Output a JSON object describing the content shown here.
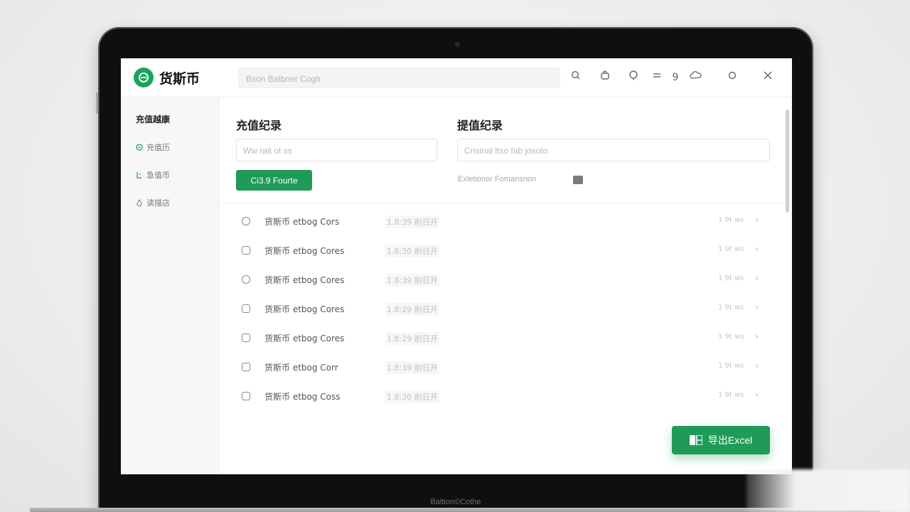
{
  "device": {
    "chin_label": "Baltion©Cothe"
  },
  "header": {
    "brand": "货斯币",
    "search_placeholder": "Bson Batbner Cogh",
    "icons": [
      "search-icon",
      "bag-icon",
      "badge-icon",
      "equals-icon",
      "number-9-icon",
      "cloud-icon",
      "circle-icon",
      "close-icon"
    ],
    "nine_label": "9"
  },
  "sidebar": {
    "title": "充值越康",
    "items": [
      {
        "label": "充值历",
        "icon": "clock-circle-icon"
      },
      {
        "label": "急值币",
        "icon": "document-icon"
      },
      {
        "label": "读描店",
        "icon": "drop-icon"
      }
    ]
  },
  "recharge": {
    "title": "充值纪录",
    "input_placeholder": "Ww rait ot ss",
    "button_label": "Ci3.9 Fourte"
  },
  "withdraw": {
    "title": "提值纪录",
    "input_placeholder": "Crisinal ltso fab josoto",
    "hint": "Exletionor Fomansnon"
  },
  "rows": [
    {
      "name": "货斯币 etbog Cors",
      "time": "1.8:39 削日开",
      "value": "1 9t ws",
      "icon": "round"
    },
    {
      "name": "货斯币 etbog Cores",
      "time": "1.8:30 削日开",
      "value": "1 9t ws",
      "icon": "square"
    },
    {
      "name": "货斯币 etbog Cores",
      "time": "1.8:39 削日开",
      "value": "1 9t ws",
      "icon": "round"
    },
    {
      "name": "货斯币 etbog Cores",
      "time": "1.8:29 削日开",
      "value": "1 9t ws",
      "icon": "square"
    },
    {
      "name": "货斯币 etbog Cores",
      "time": "1.8:29 削日开",
      "value": "1 9t ws",
      "icon": "square"
    },
    {
      "name": "货斯币 etbog Corr",
      "time": "1.8:39 削日开",
      "value": "1 9t ws",
      "icon": "square"
    },
    {
      "name": "货斯币 etbog Coss",
      "time": "1.8:30 削日开",
      "value": "1 9t ws",
      "icon": "square"
    }
  ],
  "export": {
    "label": "导出Excel"
  },
  "colors": {
    "accent": "#1f9a57",
    "brand_logo": "#18a558"
  }
}
